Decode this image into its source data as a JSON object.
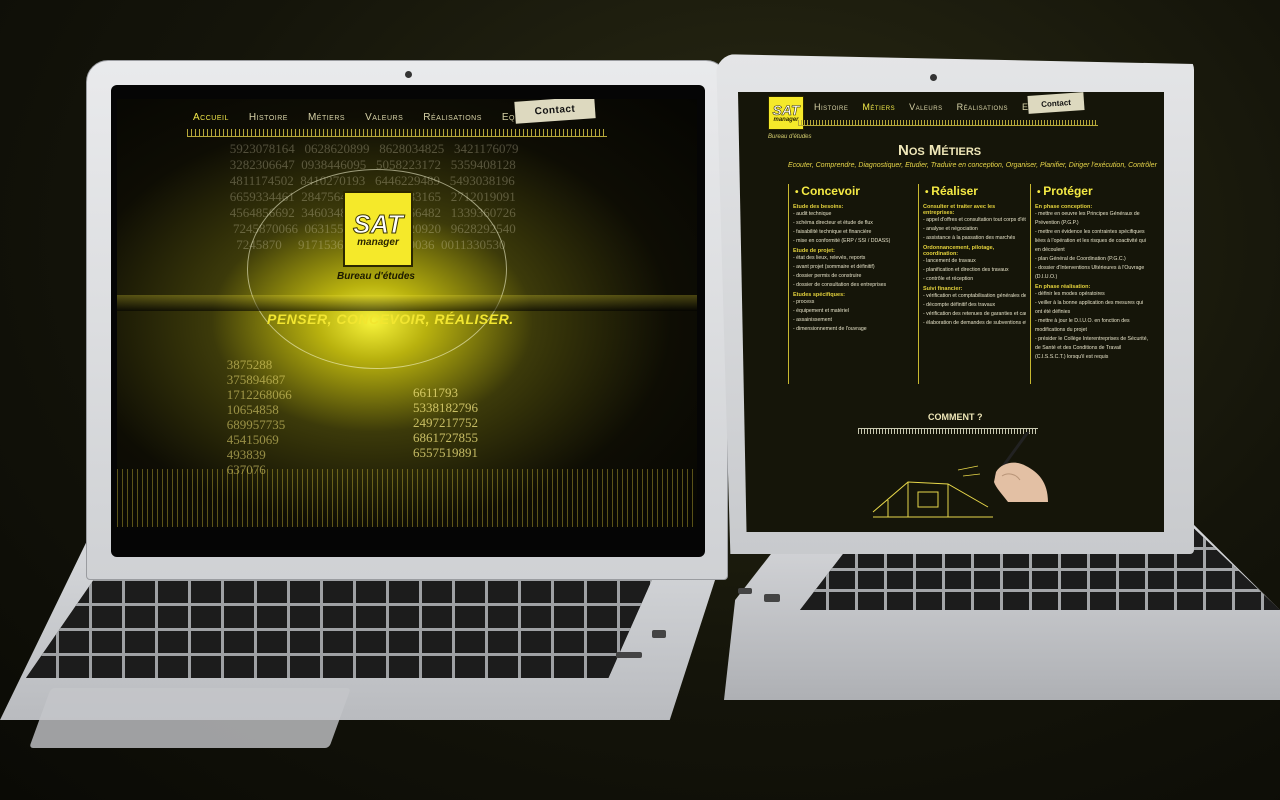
{
  "left_screen": {
    "nav": [
      "Accueil",
      "Histoire",
      "Métiers",
      "Valeurs",
      "Réalisations",
      "Equipe"
    ],
    "contact": "Contact",
    "logo": {
      "brand": "SAT",
      "subtitle": "manager",
      "caption": "Bureau d'études"
    },
    "tagline": "PENSER, CONCEVOIR, RÉALISER.",
    "numbers_top": "       5923078164   0628620899   8628034825   3421176079\n       3282306647  0938446095   5058223172   5359408128\n       4811174502  8410270193   6446229489   5493038196\n       6659334461  2847564823   3786783165   2712019091\n       4564856692  3460348610   4543266482   1339360726\n        7245870066  0631558817  4881520920   9628292540\n         7245870     9171536436    789259036  0011330530",
    "numbers_bottom": "   3875288\n   375894687\n   1712268066\n   10654858\n   689957735\n   45415069\n   493839\n   637076",
    "numbers_bottom_right": "6611793\n5338182796\n2497217752\n6861727855\n6557519891"
  },
  "right_screen": {
    "logo": {
      "brand": "SAT",
      "subtitle": "manager",
      "caption": "Bureau d'études"
    },
    "nav": [
      "Histoire",
      "Métiers",
      "Valeurs",
      "Réalisations",
      "Equipe"
    ],
    "contact": "Contact",
    "title": "Nos Métiers",
    "intro": "Ecouter, Comprendre, Diagnostiquer, Etudier, Traduire en conception, Organiser, Planifier, Diriger l'exécution, Contrôler",
    "columns": [
      {
        "heading": "Concevoir",
        "blocks": [
          {
            "sub": "Etude des besoins:",
            "lines": [
              "- audit technique",
              "- schéma directeur et étude de flux",
              "- faisabilité technique et financière",
              "- mise en conformité (ERP / SSI / DDASS)"
            ]
          },
          {
            "sub": "Etude de projet:",
            "lines": [
              "- état des lieux, relevés, reports",
              "- avant projet (sommaire et définitif)",
              "- dossier permis de construire",
              "- dossier de consultation des entreprises"
            ]
          },
          {
            "sub": "Etudes spécifiques:",
            "lines": [
              "- process",
              "- équipement et matériel",
              "- assainissement",
              "- dimensionnement de l'ouvrage"
            ]
          }
        ]
      },
      {
        "heading": "Réaliser",
        "blocks": [
          {
            "sub": "Consulter et traiter avec les entreprises:",
            "lines": [
              "- appel d'offres et consultation tout corps d'état",
              "- analyse et négociation",
              "- assistance à la passation des marchés"
            ]
          },
          {
            "sub": "Ordonnancement, pilotage, coordination:",
            "lines": [
              "- lancement de travaux",
              "- planification et direction des travaux",
              "- contrôle et réception"
            ]
          },
          {
            "sub": "Suivi financier:",
            "lines": [
              "- vérification et comptabilisation générales des situations",
              "- décompte définitif des travaux",
              "- vérification des retenues de garanties et cautions bancaires",
              "- élaboration de demandes de subventions et obtentions"
            ]
          }
        ]
      },
      {
        "heading": "Protéger",
        "blocks": [
          {
            "sub": "En phase conception:",
            "lines": [
              "- mettre en oeuvre les Principes Généraux de",
              "Prévention (P.G.P.)",
              "- mettre en évidence les contraintes spécifiques",
              "liées à l'opération et les risques de coactivité qui",
              "en découlent",
              "- plan Général de Coordination (P.G.C.)",
              "- dossier d'Interventions Ultérieures à l'Ouvrage",
              "(D.I.U.O.)"
            ]
          },
          {
            "sub": "En phase réalisation:",
            "lines": [
              "- définir les modes opératoires",
              "- veiller à la bonne application des mesures qui",
              "ont été définies",
              "- mettre à jour le D.I.U.O. en fonction des",
              "modifications du projet",
              "- présider le Collège Interentreprises de Sécurité,",
              "de Santé et des Conditions de Travail",
              "(C.I.S.S.C.T.) lorsqu'il est requis"
            ]
          }
        ]
      }
    ],
    "comment": "COMMENT ?"
  },
  "colors": {
    "accent": "#f5e92a",
    "background": "#0a0a05",
    "aluminium": "#d6d8db"
  }
}
